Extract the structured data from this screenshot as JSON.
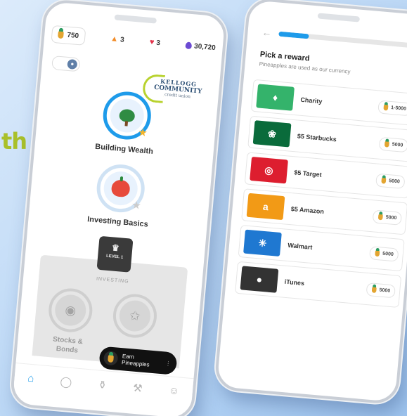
{
  "side_text": "th",
  "left_phone": {
    "stats": {
      "pineapples": "750",
      "streak": "3",
      "hearts": "3",
      "gems": "30,720"
    },
    "logo": {
      "line1": "KELLOGG",
      "line2": "COMMUNITY",
      "line3": "credit union"
    },
    "lessons": [
      {
        "title": "Building Wealth"
      },
      {
        "title": "Investing Basics"
      }
    ],
    "level_badge": "LEVEL 1",
    "section_label": "INVESTING",
    "locked_lessons": [
      {
        "title_line1": "Stocks &",
        "title_line2": "Bonds"
      }
    ],
    "earn_pill": {
      "line1": "Earn",
      "line2": "Pineapples"
    }
  },
  "right_phone": {
    "progress_percent": 22,
    "heading": "Pick a reward",
    "subheading": "Pineapples are used as our currency",
    "rewards": [
      {
        "name": "Charity",
        "price": "1-5000",
        "color": "#34b36b"
      },
      {
        "name": "$5 Starbucks",
        "price": "5000",
        "color": "#0a6b3b"
      },
      {
        "name": "$5 Target",
        "price": "5000",
        "color": "#dd1e2f"
      },
      {
        "name": "$5 Amazon",
        "price": "5000",
        "color": "#f29a16"
      },
      {
        "name": "Walmart",
        "price": "5000",
        "color": "#1f78d1"
      },
      {
        "name": "iTunes",
        "price": "5000",
        "color": "#333333"
      }
    ]
  }
}
